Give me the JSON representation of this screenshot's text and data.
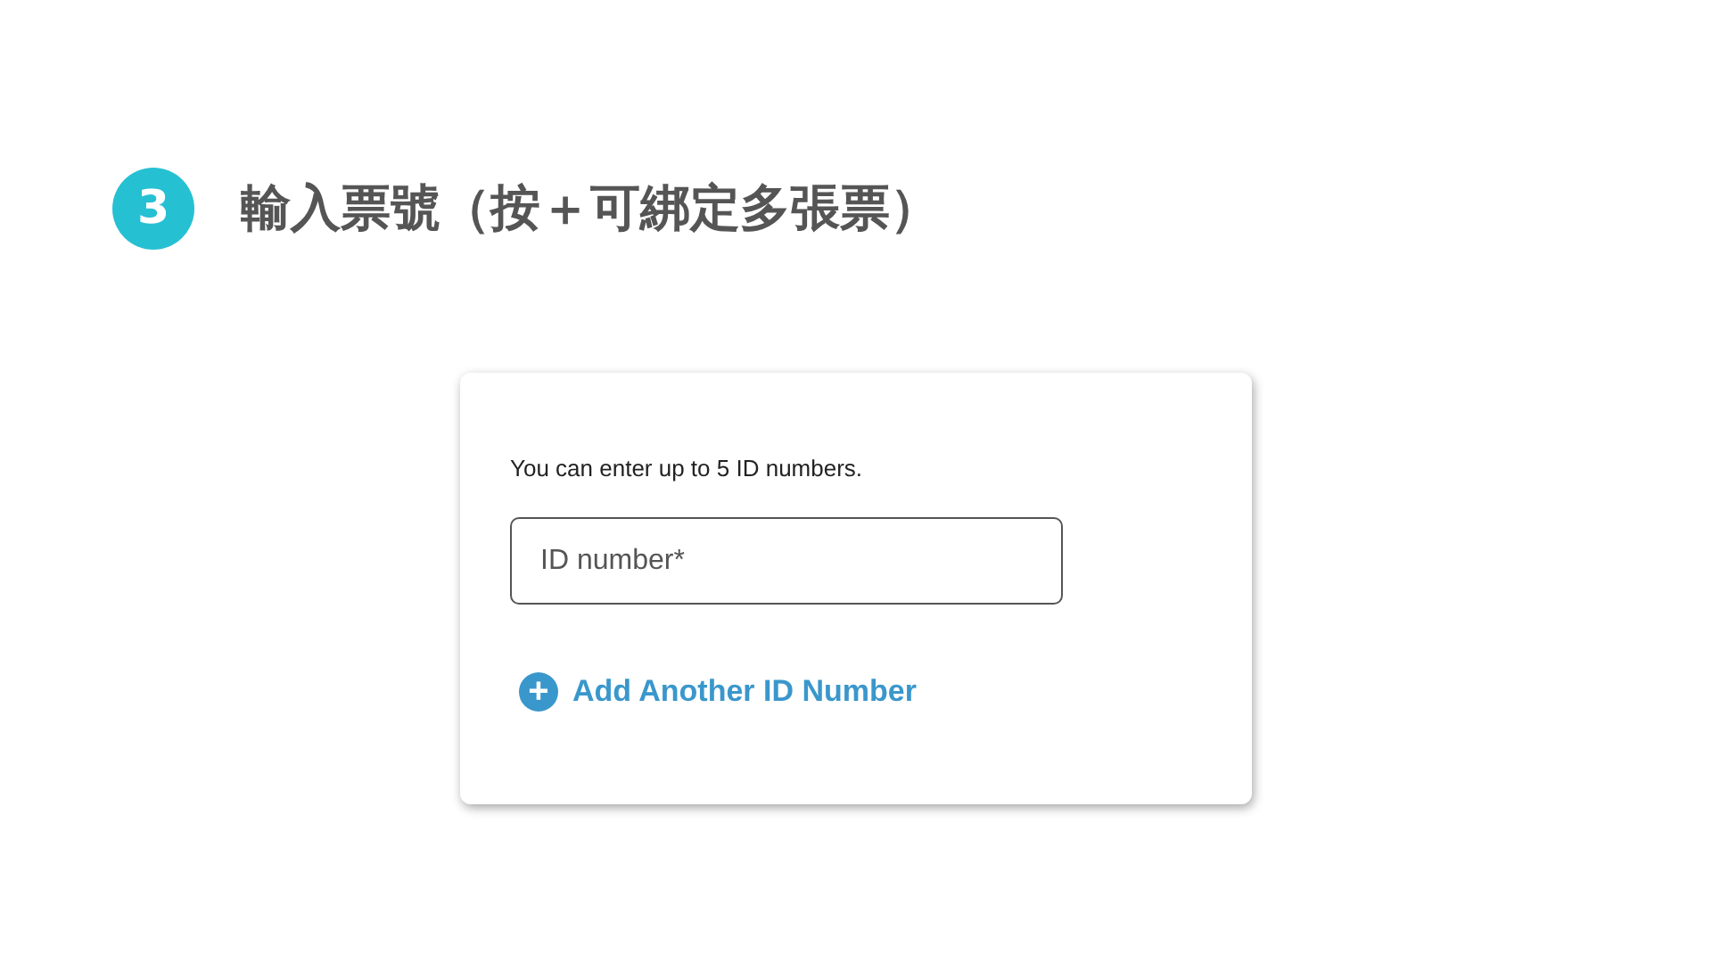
{
  "step": {
    "number": "3",
    "title": "輸入票號（按＋可綁定多張票）"
  },
  "card": {
    "hint": "You can enter up to 5 ID numbers.",
    "field": {
      "placeholder": "ID number*"
    },
    "add_link": {
      "icon": "+",
      "label": "Add Another ID Number"
    }
  }
}
